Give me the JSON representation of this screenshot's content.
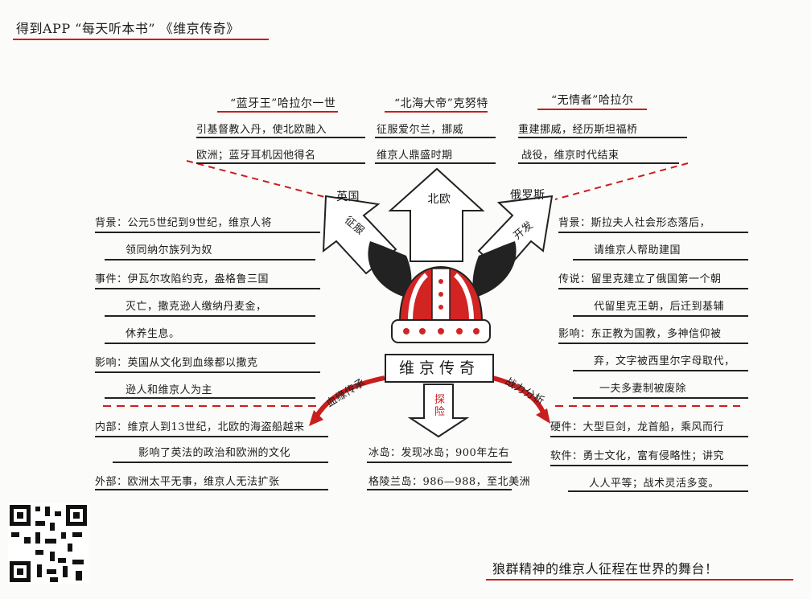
{
  "header": {
    "title": "得到APP “每天听本书” 《维京传奇》"
  },
  "center": {
    "label": "维京传奇"
  },
  "top_arrows": {
    "england": {
      "label": "英国",
      "sub": "征服"
    },
    "north": {
      "label": "北欧"
    },
    "russia": {
      "label": "俄罗斯",
      "sub": "开发"
    }
  },
  "top_panels": [
    {
      "title": "“蓝牙王”哈拉尔一世",
      "lines": [
        "引基督教入丹，使北欧融入",
        "欧洲；蓝牙耳机因他得名"
      ]
    },
    {
      "title": "“北海大帝”克努特",
      "lines": [
        "征服爱尔兰，挪威",
        "维京人鼎盛时期"
      ]
    },
    {
      "title": "“无情者”哈拉尔",
      "lines": [
        "重建挪威，经历斯坦福桥",
        "战役，维京时代结束"
      ]
    }
  ],
  "left_panel": {
    "items": [
      {
        "label": "背景",
        "lines": [
          "背景：公元5世纪到9世纪，维京人将",
          "领同纳尔族列为奴"
        ]
      },
      {
        "label": "事件",
        "lines": [
          "事件：伊瓦尔攻陷约克，盎格鲁三国",
          "灭亡，撒克逊人缴纳丹麦金，",
          "休养生息。"
        ]
      },
      {
        "label": "影响",
        "lines": [
          "影响：英国从文化到血缘都以撒克",
          "逊人和维京人为主"
        ]
      }
    ]
  },
  "right_panel": {
    "items": [
      {
        "label": "背景",
        "lines": [
          "背景：斯拉夫人社会形态落后，",
          "请维京人帮助建国"
        ]
      },
      {
        "label": "传说",
        "lines": [
          "传说：留里克建立了俄国第一个朝",
          "代留里克王朝，后迁到基辅"
        ]
      },
      {
        "label": "影响",
        "lines": [
          "影响：东正教为国教，多神信仰被",
          "弃，文字被西里尔字母取代，",
          "一夫多妻制被废除"
        ]
      }
    ]
  },
  "bottom_left": {
    "branch_label": "血缘传承",
    "items": [
      {
        "label": "内部",
        "lines": [
          "内部：维京人到13世纪，北欧的海盗船越来",
          "影响了英法的政治和欧洲的文化"
        ]
      },
      {
        "label": "外部",
        "lines": [
          "外部：欧洲太平无事，维京人无法扩张"
        ]
      }
    ]
  },
  "bottom_center": {
    "branch_label": "探险",
    "lines": [
      "冰岛：发现冰岛；900年左右",
      "格陵兰岛：986—988，至北美洲"
    ]
  },
  "bottom_right": {
    "branch_label": "战力分析",
    "items": [
      {
        "label": "硬件",
        "lines": [
          "硬件：大型巨剑，龙首船，乘风而行"
        ]
      },
      {
        "label": "软件",
        "lines": [
          "软件：勇士文化，富有侵略性；讲究",
          "人人平等；战术灵活多变。"
        ]
      }
    ]
  },
  "footer": {
    "slogan": "狼群精神的维京人征程在世界的舞台！"
  },
  "colors": {
    "accent_red": "#c81e1e",
    "ink": "#1c1c1c",
    "paper": "#fbfbf9"
  }
}
